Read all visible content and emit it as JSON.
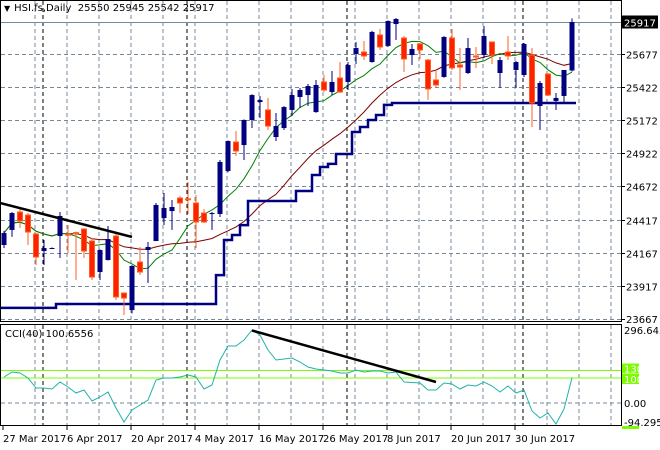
{
  "header": {
    "symbol": "HSI.fs,Daily",
    "open": "25550",
    "high": "25945",
    "low": "25542",
    "close": "25917"
  },
  "colors": {
    "bull": "#000080",
    "bear": "#FF2200",
    "bear_border": "#FF6020",
    "ma_fast": "#008000",
    "ma_slow": "#800000",
    "support": "#000080",
    "cci": "#20B2AA",
    "levels": "#7CFC00",
    "grid": "#778899"
  },
  "chart_data": [
    {
      "type": "candlestick",
      "title": "HSI.fs,Daily",
      "price_ticks": [
        "25917",
        "25677",
        "25422",
        "25172",
        "24922",
        "24672",
        "24417",
        "24167",
        "23917",
        "23667"
      ],
      "current_price_label": "25917",
      "ylim": [
        23667,
        26084
      ],
      "date_labels": [
        {
          "bar": 0,
          "label": "27 Mar 2017"
        },
        {
          "bar": 8,
          "label": "6 Apr 2017"
        },
        {
          "bar": 16,
          "label": "20 Apr 2017"
        },
        {
          "bar": 24,
          "label": "4 May 2017"
        },
        {
          "bar": 32,
          "label": "16 May 2017"
        },
        {
          "bar": 40,
          "label": "26 May 2017"
        },
        {
          "bar": 48,
          "label": "8 Jun 2017"
        },
        {
          "bar": 56,
          "label": "20 Jun 2017"
        },
        {
          "bar": 64,
          "label": "30 Jun 2017"
        }
      ],
      "ohlc": [
        [
          24228,
          24335,
          24205,
          24319
        ],
        [
          24342,
          24478,
          24289,
          24470
        ],
        [
          24478,
          24516,
          24357,
          24410
        ],
        [
          24455,
          24470,
          24228,
          24326
        ],
        [
          24311,
          24320,
          24076,
          24137
        ],
        [
          24182,
          24266,
          24076,
          24205
        ],
        [
          24205,
          24210,
          24200,
          24205
        ],
        [
          24296,
          24478,
          24129,
          24448
        ],
        [
          24310,
          24379,
          24167,
          24304
        ],
        [
          24322,
          24330,
          23963,
          24316
        ],
        [
          24349,
          24355,
          24129,
          24182
        ],
        [
          24258,
          24281,
          23963,
          23985
        ],
        [
          24023,
          24195,
          23963,
          24190
        ],
        [
          24114,
          24372,
          24110,
          24273
        ],
        [
          24296,
          24311,
          23811,
          23834
        ],
        [
          23864,
          23870,
          23698,
          23826
        ],
        [
          23735,
          24075,
          23710,
          24069
        ],
        [
          24099,
          24213,
          24001,
          24023
        ],
        [
          24190,
          24251,
          23940,
          24213
        ],
        [
          24258,
          24546,
          24258,
          24531
        ],
        [
          24432,
          24622,
          24379,
          24508
        ],
        [
          24485,
          24569,
          24342,
          24516
        ],
        [
          24584,
          24599,
          24470,
          24546
        ],
        [
          24578,
          24705,
          24463,
          24574
        ],
        [
          24546,
          24607,
          24205,
          24402
        ],
        [
          24470,
          24500,
          24395,
          24402
        ],
        [
          24463,
          24478,
          24342,
          24470
        ],
        [
          24463,
          24872,
          24440,
          24857
        ],
        [
          24789,
          25020,
          24780,
          25016
        ],
        [
          25008,
          25092,
          24902,
          24940
        ],
        [
          24985,
          25180,
          24872,
          25175
        ],
        [
          25175,
          25370,
          25114,
          25364
        ],
        [
          25311,
          25357,
          25190,
          25326
        ],
        [
          25251,
          25342,
          25099,
          25129
        ],
        [
          25046,
          25228,
          25016,
          25129
        ],
        [
          25114,
          25280,
          25099,
          25273
        ],
        [
          25251,
          25410,
          25205,
          25364
        ],
        [
          25349,
          25417,
          25266,
          25402
        ],
        [
          25364,
          25448,
          25281,
          25432
        ],
        [
          25235,
          25478,
          25230,
          25440
        ],
        [
          25463,
          25516,
          25387,
          25402
        ],
        [
          25387,
          25546,
          25364,
          25463
        ],
        [
          25493,
          25614,
          25379,
          25387
        ],
        [
          25463,
          25614,
          25402,
          25592
        ],
        [
          25675,
          25766,
          25599,
          25720
        ],
        [
          25690,
          25773,
          25629,
          25660
        ],
        [
          25614,
          25850,
          25610,
          25842
        ],
        [
          25819,
          25864,
          25705,
          25728
        ],
        [
          25736,
          25930,
          25730,
          25925
        ],
        [
          25902,
          25948,
          25781,
          25940
        ],
        [
          25796,
          25811,
          25539,
          25637
        ],
        [
          25667,
          25751,
          25592,
          25713
        ],
        [
          25751,
          25758,
          25637,
          25705
        ],
        [
          25629,
          25637,
          25326,
          25410
        ],
        [
          25478,
          25554,
          25417,
          25440
        ],
        [
          25501,
          25810,
          25495,
          25804
        ],
        [
          25796,
          25864,
          25554,
          25569
        ],
        [
          25592,
          25720,
          25402,
          25576
        ],
        [
          25531,
          25796,
          25523,
          25720
        ],
        [
          25660,
          25728,
          25569,
          25652
        ],
        [
          25667,
          25887,
          25645,
          25811
        ],
        [
          25766,
          25766,
          25599,
          25667
        ],
        [
          25531,
          25652,
          25417,
          25629
        ],
        [
          25690,
          25811,
          25629,
          25660
        ],
        [
          25554,
          25622,
          25417,
          25614
        ],
        [
          25516,
          25758,
          25500,
          25751
        ],
        [
          25667,
          25720,
          25122,
          25304
        ],
        [
          25281,
          25470,
          25099,
          25455
        ],
        [
          25523,
          25530,
          25357,
          25364
        ],
        [
          25319,
          25379,
          25251,
          25342
        ],
        [
          25357,
          25554,
          25311,
          25554
        ],
        [
          25550,
          25945,
          25542,
          25917
        ]
      ],
      "ma_fast_period": 8,
      "ma_slow_period": 21,
      "support_line": [
        23751,
        23751,
        23751,
        23751,
        23751,
        23751,
        23751,
        23781,
        23781,
        23781,
        23781,
        23781,
        23781,
        23781,
        23781,
        23781,
        23781,
        23781,
        23781,
        23781,
        23781,
        23781,
        23781,
        23781,
        23781,
        23781,
        23781,
        24000,
        24266,
        24304,
        24379,
        24561,
        24561,
        24561,
        24561,
        24561,
        24561,
        24637,
        24637,
        24758,
        24819,
        24842,
        24917,
        24917,
        25084,
        25122,
        25175,
        25213,
        25289,
        25304,
        25304,
        25304,
        25304,
        25304,
        25304,
        25304,
        25304,
        25304,
        25304,
        25304,
        25304,
        25304,
        25304,
        25304,
        25304,
        25304,
        25304,
        25304,
        25304,
        25304,
        25304,
        25304
      ],
      "trendline": {
        "from": {
          "bar": -0.5,
          "price": 24546
        },
        "to": {
          "bar": 16,
          "price": 24289
        }
      }
    },
    {
      "type": "line",
      "title": "CCI(40)",
      "current_value": "100.6556",
      "label": "CCI(40) 100.6556",
      "axis_labels": {
        "max": "296.6436",
        "level_high": "130",
        "level_low": "100",
        "zero": "0.00",
        "min": "-94.2953"
      },
      "ylim": [
        -94.2953,
        296.6436
      ],
      "levels": [
        130,
        100
      ],
      "values": [
        104,
        124,
        120,
        100,
        60,
        60,
        56,
        84,
        64,
        40,
        52,
        8,
        24,
        44,
        -20,
        -76,
        -28,
        -8,
        12,
        92,
        100,
        100,
        104,
        112,
        104,
        56,
        72,
        172,
        228,
        228,
        252,
        292,
        272,
        212,
        172,
        176,
        180,
        164,
        144,
        136,
        132,
        128,
        120,
        120,
        132,
        124,
        128,
        128,
        120,
        124,
        84,
        82,
        80,
        52,
        52,
        80,
        76,
        56,
        72,
        68,
        84,
        68,
        44,
        68,
        40,
        52,
        -32,
        -60,
        -40,
        -84,
        -24,
        100.66
      ],
      "trendline": {
        "from": {
          "bar": 31,
          "value": 290
        },
        "to": {
          "bar": 54,
          "value": 84
        }
      }
    }
  ]
}
